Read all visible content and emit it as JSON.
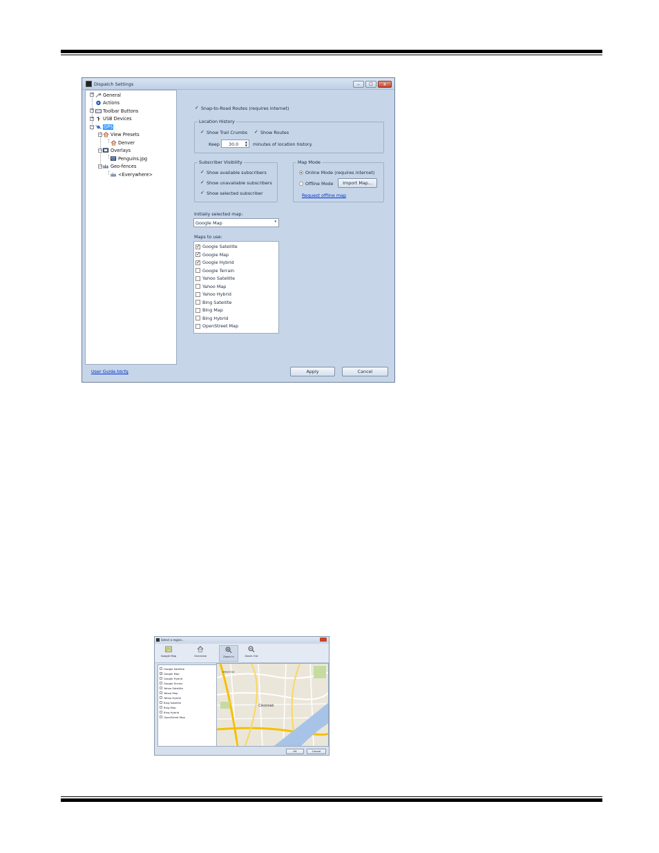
{
  "window": {
    "title": "Dispatch Settings",
    "minimize": "–",
    "maximize": "□",
    "close": "x"
  },
  "tree": {
    "general": "General",
    "actions": "Actions",
    "toolbar_buttons": "Toolbar Buttons",
    "usb_devices": "USB Devices",
    "gps": "GPS",
    "view_presets": "View Presets",
    "denver": "Denver",
    "overlays": "Overlays",
    "penguins": "Penguins.jpg",
    "geofences": "Geo-fences",
    "everywhere": "<Everywhere>"
  },
  "footer": {
    "user_guide": "User Guide.tdcfg",
    "apply": "Apply",
    "cancel": "Cancel"
  },
  "settings": {
    "snap_to_road": "Snap-to-Road Routes (requires internet)",
    "location_history": {
      "label": "Location History",
      "show_trail_crumbs": "Show Trail Crumbs",
      "show_routes": "Show Routes",
      "keep": "Keep",
      "keep_value": "30.0",
      "keep_suffix": "minutes of location history."
    },
    "subscriber_visibility": {
      "label": "Subscriber Visibility",
      "show_available": "Show available subscribers",
      "show_unavailable": "Show unavailable subscribers",
      "show_selected": "Show selected subscriber"
    },
    "map_mode": {
      "label": "Map Mode",
      "online": "Online Mode (requires internet)",
      "offline": "Offline Mode",
      "import": "Import Map...",
      "request_offline": "Request offline map"
    },
    "initial_map_label": "Initially selected map:",
    "initial_map_value": "Google Map",
    "maps_to_use_label": "Maps to use:",
    "maps": [
      {
        "name": "Google Satellite",
        "checked": true
      },
      {
        "name": "Google Map",
        "checked": true
      },
      {
        "name": "Google Hybrid",
        "checked": true
      },
      {
        "name": "Google Terrain",
        "checked": false
      },
      {
        "name": "Yahoo Satellite",
        "checked": false
      },
      {
        "name": "Yahoo Map",
        "checked": false
      },
      {
        "name": "Yahoo Hybrid",
        "checked": false
      },
      {
        "name": "Bing Satellite",
        "checked": false
      },
      {
        "name": "Bing Map",
        "checked": false
      },
      {
        "name": "Bing Hybrid",
        "checked": false
      },
      {
        "name": "OpenStreet Map",
        "checked": false
      }
    ]
  },
  "region_dialog": {
    "title": "Select a region...",
    "toolbar": {
      "google_map": "Google Map",
      "overview": "Overview",
      "zoom_in": "Zoom In",
      "zoom_out": "Zoom Out"
    },
    "maps": [
      {
        "name": "Google Satellite",
        "checked": false
      },
      {
        "name": "Google Map",
        "checked": true
      },
      {
        "name": "Google Hybrid",
        "checked": false
      },
      {
        "name": "Google Terrain",
        "checked": false
      },
      {
        "name": "Yahoo Satellite",
        "checked": false
      },
      {
        "name": "Yahoo Map",
        "checked": false
      },
      {
        "name": "Yahoo Hybrid",
        "checked": false
      },
      {
        "name": "Bing Satellite",
        "checked": false
      },
      {
        "name": "Bing Map",
        "checked": false
      },
      {
        "name": "Bing Hybrid",
        "checked": false
      },
      {
        "name": "OpenStreet Map",
        "checked": false
      }
    ],
    "map_labels": {
      "city": "Cincinnati",
      "area": "West End"
    },
    "ok": "OK",
    "cancel": "Cancel"
  }
}
